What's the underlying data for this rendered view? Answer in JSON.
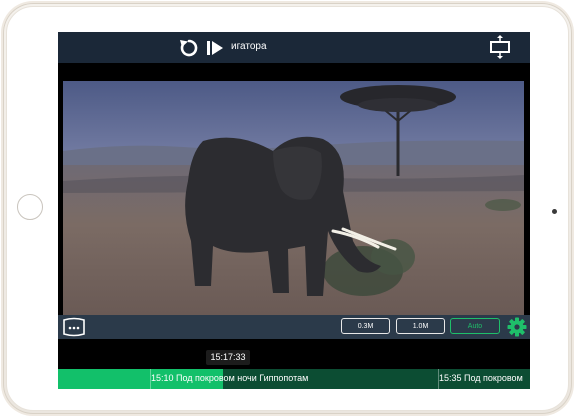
{
  "player": {
    "title": "игатора",
    "icons": {
      "replay": "replay-icon",
      "play": "play-icon",
      "expand": "expand-vertical-icon",
      "guide": "tv-guide-icon",
      "settings": "gear-icon"
    }
  },
  "quality": {
    "options": [
      "0.3M",
      "1.0M",
      "Auto"
    ],
    "selected": "Auto",
    "accent": "#1fbf6a"
  },
  "timeline": {
    "current_time": "15:17:33",
    "progress_fraction": 0.35,
    "programs": [
      {
        "label": "15:10 Под покровом ночи Гиппопотам"
      },
      {
        "label": "15:35 Под покровом"
      }
    ],
    "colors": {
      "progress": "#12c06a",
      "track": "#0c4d33"
    }
  }
}
